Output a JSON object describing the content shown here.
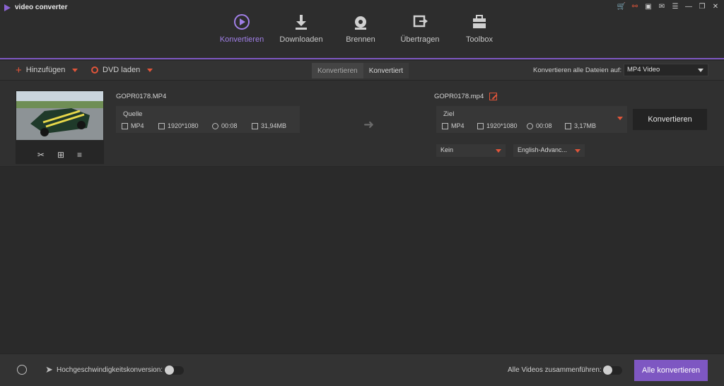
{
  "app": {
    "title": "video converter"
  },
  "window_controls": [
    "cart-icon",
    "user-icon",
    "gift-icon",
    "feedback-icon",
    "menu-icon",
    "minimize-icon",
    "restore-icon",
    "close-icon"
  ],
  "nav": {
    "items": [
      {
        "label": "Konvertieren",
        "icon": "convert-icon",
        "active": true
      },
      {
        "label": "Downloaden",
        "icon": "download-icon",
        "active": false
      },
      {
        "label": "Brennen",
        "icon": "burn-icon",
        "active": false
      },
      {
        "label": "Übertragen",
        "icon": "transfer-icon",
        "active": false
      },
      {
        "label": "Toolbox",
        "icon": "toolbox-icon",
        "active": false
      }
    ]
  },
  "toolbar": {
    "add_label": "Hinzufügen",
    "dvd_label": "DVD laden",
    "tab_converting": "Konvertieren",
    "tab_converted": "Konvertiert",
    "format_label": "Konvertieren alle Dateien auf:",
    "format_value": "MP4 Video"
  },
  "item": {
    "source": {
      "filename": "GOPR0178.MP4",
      "title": "Quelle",
      "format": "MP4",
      "resolution": "1920*1080",
      "duration": "00:08",
      "size": "31,94MB"
    },
    "target": {
      "filename": "GOPR0178.mp4",
      "title": "Ziel",
      "format": "MP4",
      "resolution": "1920*1080",
      "duration": "00:08",
      "size": "3,17MB"
    },
    "convert_label": "Konvertieren",
    "subtitle_value": "Kein",
    "audio_value": "English-Advanc..."
  },
  "bottom": {
    "hs_label": "Hochgeschwindigkeitskonversion:",
    "merge_label": "Alle Videos zusammenführen:",
    "all_convert_label": "Alle konvertieren",
    "hs_enabled": false,
    "merge_enabled": false
  },
  "colors": {
    "accent": "#7e57c2",
    "highlight": "#e0553a"
  }
}
